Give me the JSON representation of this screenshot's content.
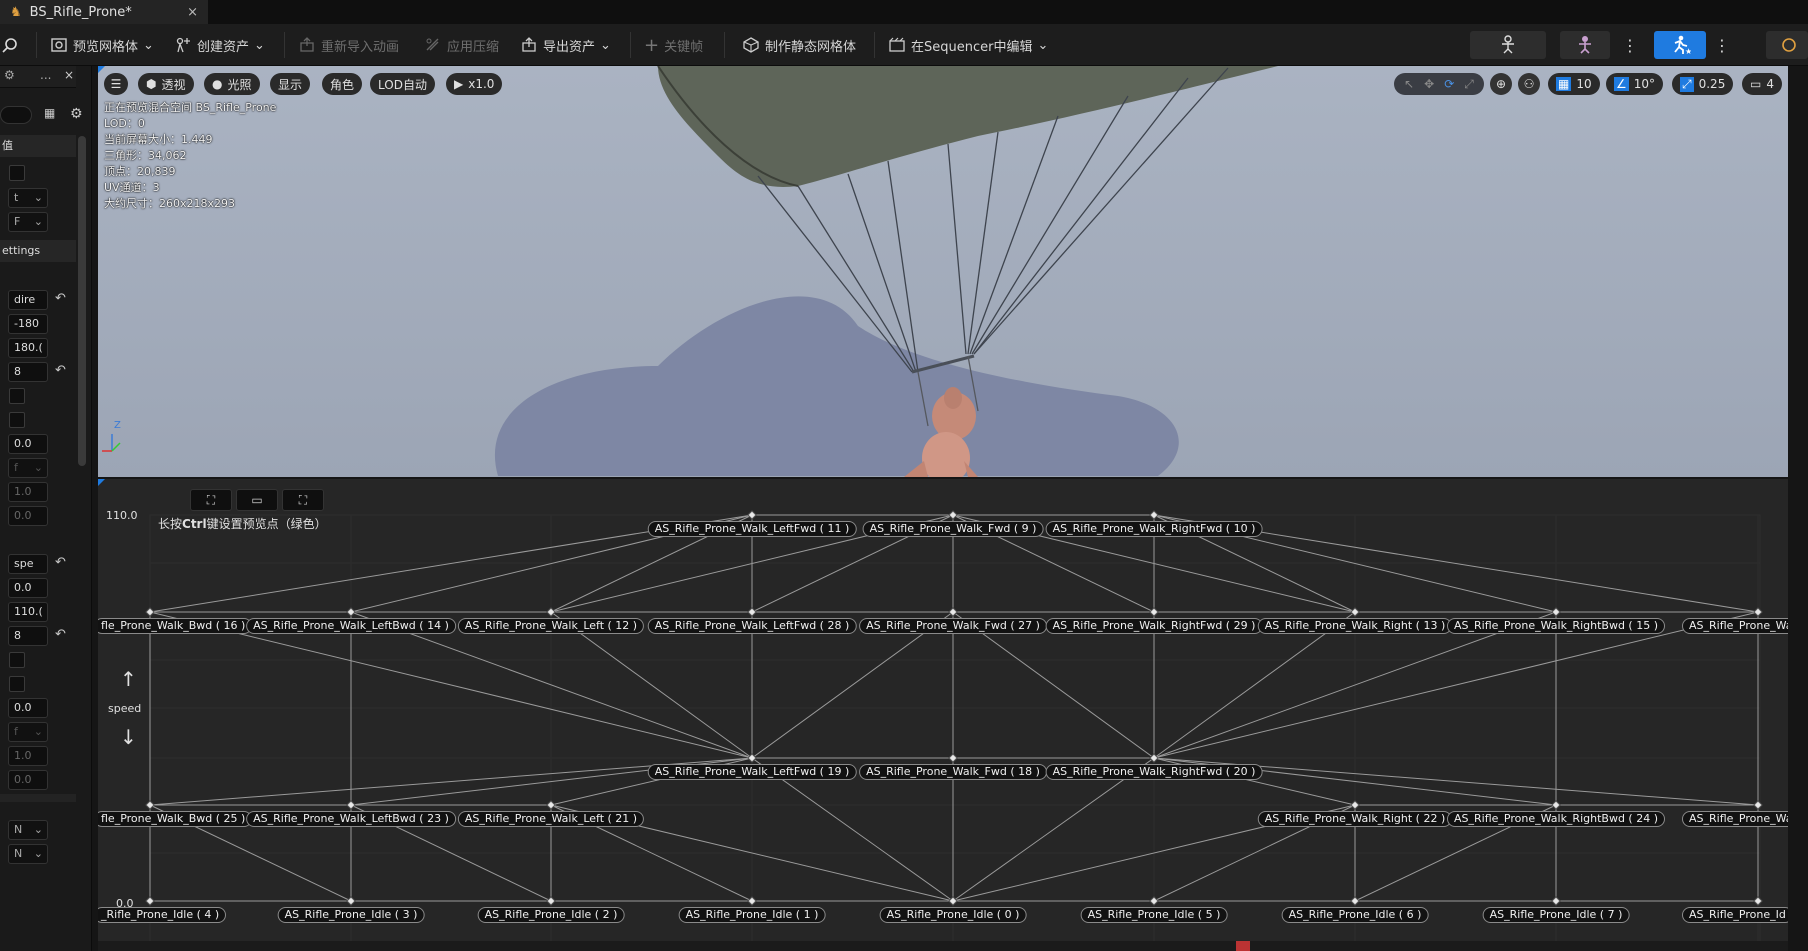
{
  "window": {
    "tab_title": "BS_Rifle_Prone*",
    "close_glyph": "×"
  },
  "toolbar": {
    "preview_mesh": "预览网格体",
    "create_asset": "创建资产",
    "reimport_anim": "重新导入动画",
    "apply_compression": "应用压缩",
    "export_asset": "导出资产",
    "keyframe": "关键帧",
    "make_static_mesh": "制作静态网格体",
    "edit_in_sequencer": "在Sequencer中编辑"
  },
  "left_panel": {
    "tab_label": "...",
    "search_placeholder": "",
    "section_values": "值",
    "section_settings": "ettings",
    "combo1": "t",
    "combo2": "F",
    "axis_x": {
      "name": "dire",
      "min": "-180",
      "max": "180.(",
      "divisions": "8"
    },
    "interp1": {
      "time": "0.0",
      "combo": "f",
      "v1": "1.0",
      "v2": "0.0"
    },
    "axis_y": {
      "name": "spe",
      "min": "0.0",
      "max": "110.(",
      "divisions": "8"
    },
    "interp2": {
      "time": "0.0",
      "combo": "f",
      "v1": "1.0",
      "v2": "0.0"
    },
    "bottom_combo1": "N",
    "bottom_combo2": "N"
  },
  "viewport": {
    "menu_icon": "hamburger-icon",
    "view_mode": "透视",
    "lighting": "光照",
    "show": "显示",
    "character": "角色",
    "lod": "LOD自动",
    "play_rate": "x1.0",
    "grid_snap": "10",
    "rot_snap": "10°",
    "scale_snap": "0.25",
    "camera_speed": "4",
    "info": [
      "正在预览混合空间 BS_Rifle_Prone",
      "LOD：0",
      "当前屏幕大小：1.449",
      "三角形：34,062",
      "顶点：20,839",
      "UV通道：3",
      "大约尺寸：260x218x293"
    ],
    "axis_z_label": "Z"
  },
  "blendspace": {
    "hint_prefix": "长按",
    "hint_key": "Ctrl",
    "hint_suffix": "键设置预览点（绿色）",
    "y_max": "110.0",
    "y_min": "0.0",
    "y_axis_name": "speed",
    "labels": {
      "n11": "AS_Rifle_Prone_Walk_LeftFwd ( 11 )",
      "n9": "AS_Rifle_Prone_Walk_Fwd ( 9 )",
      "n10": "AS_Rifle_Prone_Walk_RightFwd ( 10 )",
      "n16": "fle_Prone_Walk_Bwd ( 16 )",
      "n14": "AS_Rifle_Prone_Walk_LeftBwd ( 14 )",
      "n12": "AS_Rifle_Prone_Walk_Left ( 12 )",
      "n28": "AS_Rifle_Prone_Walk_LeftFwd ( 28 )",
      "n27": "AS_Rifle_Prone_Walk_Fwd ( 27 )",
      "n29": "AS_Rifle_Prone_Walk_RightFwd ( 29 )",
      "n13": "AS_Rifle_Prone_Walk_Right ( 13 )",
      "n15": "AS_Rifle_Prone_Walk_RightBwd ( 15 )",
      "n17": "AS_Rifle_Prone_Walk_",
      "n19": "AS_Rifle_Prone_Walk_LeftFwd ( 19 )",
      "n18": "AS_Rifle_Prone_Walk_Fwd ( 18 )",
      "n20": "AS_Rifle_Prone_Walk_RightFwd ( 20 )",
      "n25": "fle_Prone_Walk_Bwd ( 25 )",
      "n23": "AS_Rifle_Prone_Walk_LeftBwd ( 23 )",
      "n21": "AS_Rifle_Prone_Walk_Left ( 21 )",
      "n22": "AS_Rifle_Prone_Walk_Right ( 22 )",
      "n24": "AS_Rifle_Prone_Walk_RightBwd ( 24 )",
      "n26": "AS_Rifle_Prone_Walk_",
      "i4": "_Rifle_Prone_Idle ( 4 )",
      "i3": "AS_Rifle_Prone_Idle ( 3 )",
      "i2": "AS_Rifle_Prone_Idle ( 2 )",
      "i1": "AS_Rifle_Prone_Idle ( 1 )",
      "i0": "AS_Rifle_Prone_Idle ( 0 )",
      "i5": "AS_Rifle_Prone_Idle ( 5 )",
      "i6": "AS_Rifle_Prone_Idle ( 6 )",
      "i7": "AS_Rifle_Prone_Idle ( 7 )",
      "i8": "AS_Rifle_Prone_Id"
    }
  }
}
